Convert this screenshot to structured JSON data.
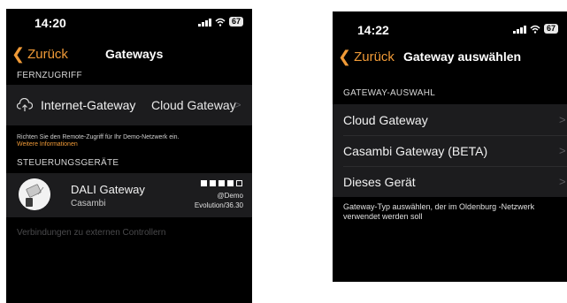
{
  "left": {
    "status": {
      "time": "14:20",
      "battery": "67"
    },
    "nav": {
      "back": "Zurück",
      "title": "Gateways"
    },
    "remote_section": "FERNZUGRIFF",
    "internet_gateway": {
      "label": "Internet-Gateway",
      "value": "Cloud Gateway"
    },
    "footnote": {
      "text": "Richten Sie den Remote-Zugriff für Ihr Demo-Netzwerk ein.",
      "link": "Weitere Informationen"
    },
    "devices_section": "STEUERUNGSGERÄTE",
    "device": {
      "name": "DALI Gateway",
      "vendor": "Casambi",
      "network": "@Demo",
      "version": "Evolution/36.30"
    },
    "external": "Verbindungen zu externen Controllern"
  },
  "right": {
    "status": {
      "time": "14:22",
      "battery": "67"
    },
    "nav": {
      "back": "Zurück",
      "title": "Gateway auswählen"
    },
    "section": "GATEWAY-AUSWAHL",
    "options": [
      {
        "label": "Cloud Gateway"
      },
      {
        "label": "Casambi Gateway (BETA)"
      },
      {
        "label": "Dieses Gerät"
      }
    ],
    "footnote": "Gateway-Typ auswählen, der im Oldenburg -Netzwerk verwendet werden soll"
  },
  "colors": {
    "accent": "#f09a37",
    "background": "#000000",
    "cell": "#1c1c1e"
  },
  "icons": [
    "chevron-left-icon",
    "signal-icon",
    "wifi-icon",
    "battery-icon",
    "cloud-upload-icon",
    "chevron-right-icon",
    "gateway-device-icon"
  ]
}
